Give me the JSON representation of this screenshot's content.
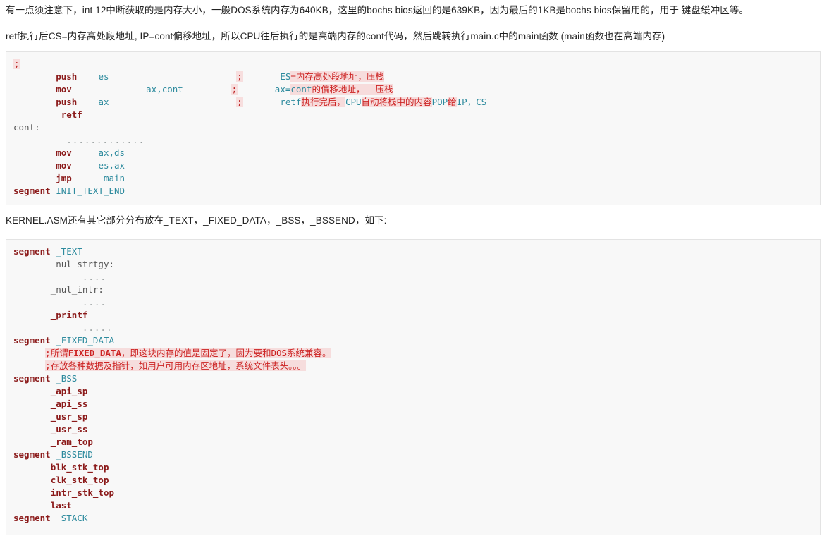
{
  "paragraphs": {
    "p1": "有一点须注意下，int 12中断获取的是内存大小，一般DOS系统内存为640KB，这里的bochs bios返回的是639KB，因为最后的1KB是bochs bios保留用的，用于 键盘缓冲区等。",
    "p2": "retf执行后CS=内存高处段地址, IP=cont偏移地址，所以CPU往后执行的是高端内存的cont代码，然后跳转执行main.c中的main函数 (main函数也在高端内存)",
    "p3": "KERNEL.ASM还有其它部分分布放在_TEXT，_FIXED_DATA，_BSS，_BSSEND，如下:"
  },
  "code_block_1": {
    "lines": [
      {
        "semicolon": ";"
      },
      {
        "mnemonic": "push",
        "operand": "es",
        "semicolon": ";",
        "comment_head": "ES",
        "comment_body": "=内存高处段地址，压栈"
      },
      {
        "mnemonic": "mov",
        "operand": "ax,cont",
        "semicolon": ";",
        "comment_head": "ax=",
        "comment_mid": "cont",
        "comment_body": "的偏移地址，  压栈"
      },
      {
        "mnemonic": "push",
        "operand": "ax",
        "semicolon": ";",
        "comment_head": "retf",
        "comment_body": "执行完后，",
        "comment_t2": "CPU",
        "comment_b2": "自动将栈中的内容",
        "comment_t3": "POP",
        "comment_b3": "给",
        "comment_t4": "IP，CS"
      },
      {
        "mnemonic": "retf"
      },
      {
        "label": "cont:"
      },
      {
        "dots": "............."
      },
      {
        "mnemonic": "mov",
        "operand": "ax,ds"
      },
      {
        "mnemonic": "mov",
        "operand": "es,ax"
      },
      {
        "mnemonic": "jmp",
        "operand": "_main"
      },
      {
        "mnemonic": "segment",
        "operand": "INIT_TEXT_END"
      }
    ]
  },
  "code_block_2": {
    "lines": [
      {
        "kind": "segment",
        "keyword": "segment",
        "name": "_TEXT"
      },
      {
        "kind": "label",
        "text": "_nul_strtgy:"
      },
      {
        "kind": "dots",
        "text": "...."
      },
      {
        "kind": "label",
        "text": "_nul_intr:"
      },
      {
        "kind": "dots",
        "text": "...."
      },
      {
        "kind": "symbol",
        "text": "_printf"
      },
      {
        "kind": "dots",
        "text": "....."
      },
      {
        "kind": "segment",
        "keyword": "segment",
        "name": "_FIXED_DATA"
      },
      {
        "kind": "comment",
        "prefix": ";所谓",
        "bold": "FIXED_DATA",
        "rest": "，即这块内存的值是固定了，因为要和DOS系统兼容。"
      },
      {
        "kind": "comment",
        "prefix": ";存放各种数据及指针，如用户可用内存区地址，系统文件表头。。。",
        "bold": "",
        "rest": ""
      },
      {
        "kind": "segment",
        "keyword": "segment",
        "name": "_BSS"
      },
      {
        "kind": "symbol",
        "text": "_api_sp"
      },
      {
        "kind": "symbol",
        "text": "_api_ss"
      },
      {
        "kind": "symbol",
        "text": "_usr_sp"
      },
      {
        "kind": "symbol",
        "text": "_usr_ss"
      },
      {
        "kind": "symbol",
        "text": "_ram_top"
      },
      {
        "kind": "segment",
        "keyword": "segment",
        "name": "_BSSEND"
      },
      {
        "kind": "symbol",
        "text": "blk_stk_top"
      },
      {
        "kind": "symbol",
        "text": "clk_stk_top"
      },
      {
        "kind": "symbol",
        "text": "intr_stk_top"
      },
      {
        "kind": "symbol",
        "text": "last"
      },
      {
        "kind": "segment",
        "keyword": "segment",
        "name": "_STACK"
      }
    ]
  },
  "colors": {
    "keyword": "#8b1a1a",
    "operand": "#2e8b9e",
    "comment_red": "#cc2222",
    "highlight_bg": "#f7dcdc",
    "code_bg": "#f8f8f8",
    "code_border": "#e3e3e3"
  }
}
